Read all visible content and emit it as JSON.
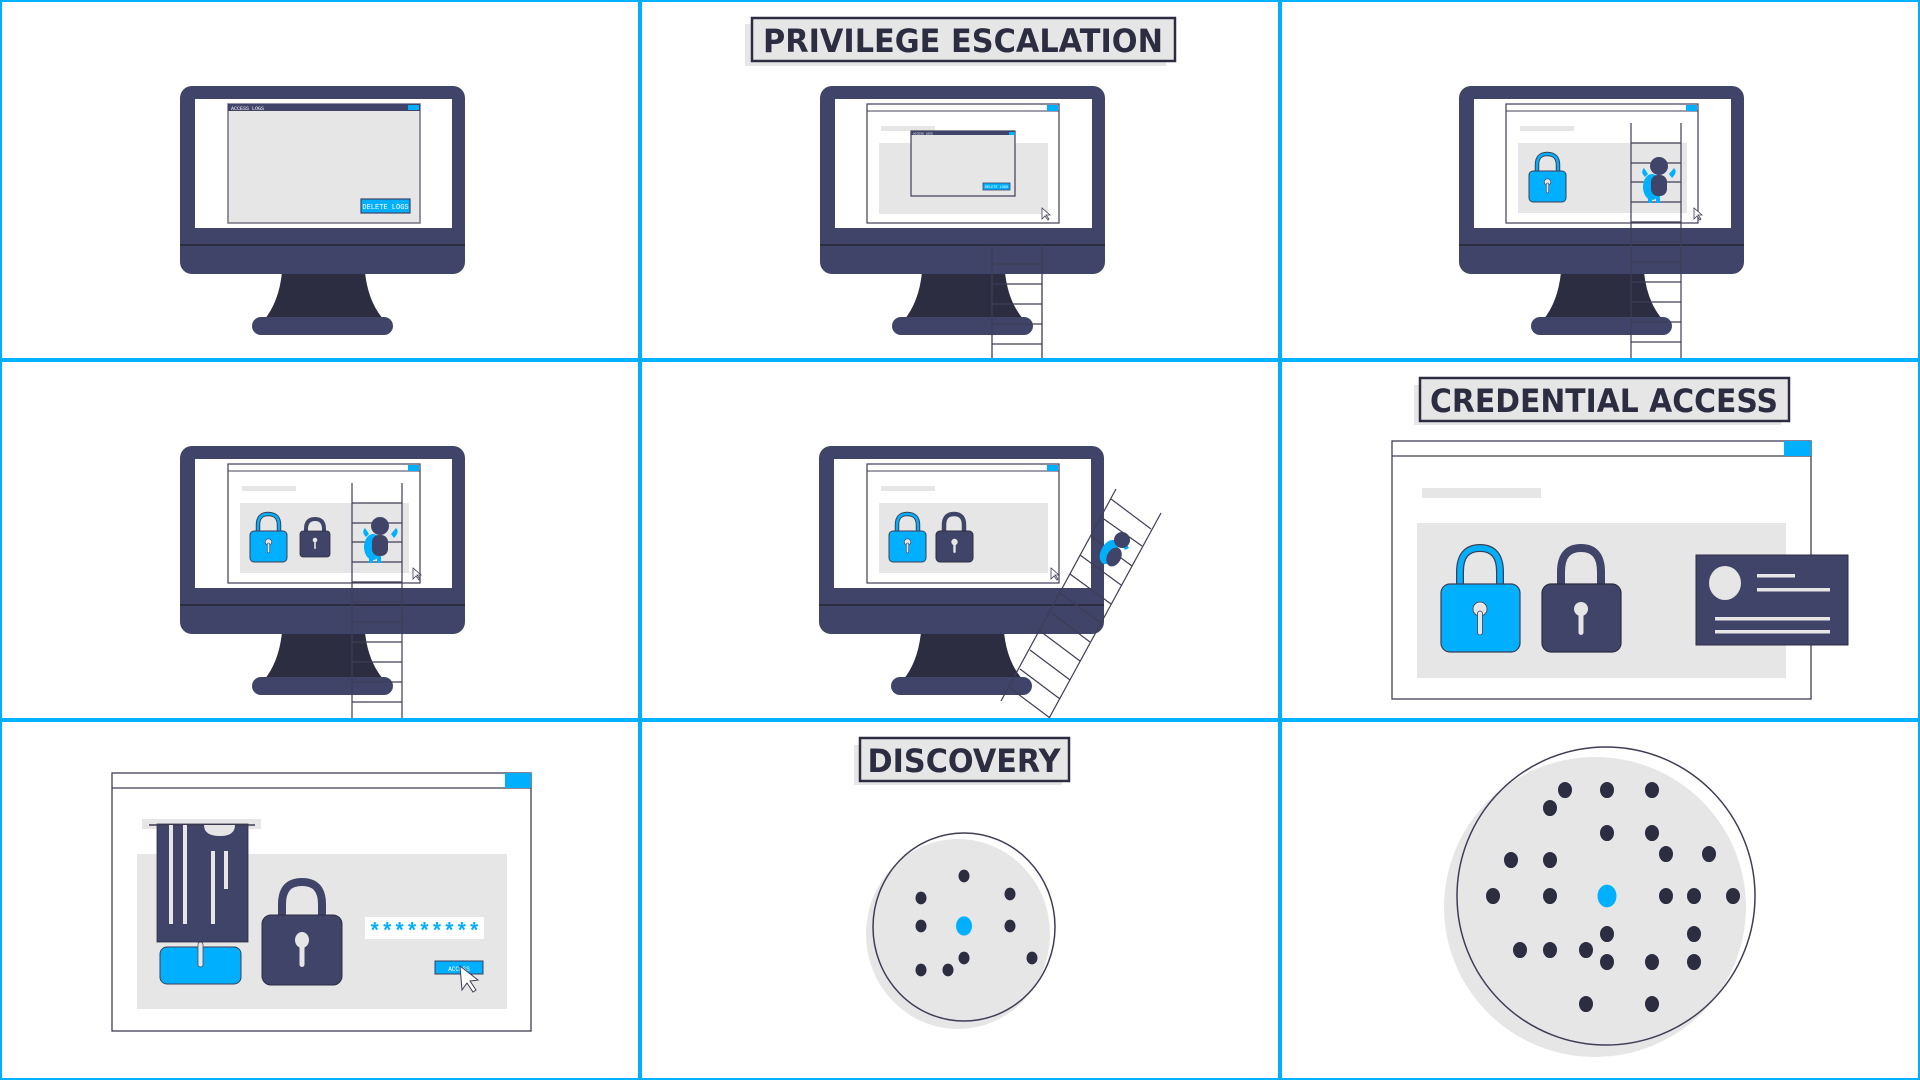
{
  "colors": {
    "accent": "#00b0ff",
    "navy": "#3f4468",
    "dark": "#2d2d42",
    "light_gray": "#e6e6e6",
    "outline": "#3f3d56",
    "white": "#ffffff"
  },
  "panels": [
    {
      "id": "panel-1",
      "title": "",
      "window_title": "ACCESS LOGS",
      "button_label": "DELETE LOGS"
    },
    {
      "id": "panel-2",
      "title": "PRIVILEGE ESCALATION",
      "window_title": "ACCESS LOGS",
      "button_label": "DELETE LOGS"
    },
    {
      "id": "panel-3",
      "title": "",
      "locks": [
        "unlocked-blue"
      ]
    },
    {
      "id": "panel-4",
      "title": "",
      "locks": [
        "unlocked-blue",
        "locked-navy"
      ]
    },
    {
      "id": "panel-5",
      "title": "",
      "locks": [
        "unlocked-blue",
        "locked-navy"
      ]
    },
    {
      "id": "panel-6",
      "title": "CREDENTIAL ACCESS",
      "locks": [
        "unlocked-blue",
        "locked-navy"
      ],
      "id_card": "user-id-card"
    },
    {
      "id": "panel-7",
      "title": "",
      "password_mask": "*********",
      "button_label": "ACCESS"
    },
    {
      "id": "panel-8",
      "title": "DISCOVERY",
      "network_nodes": 9,
      "center_node": "highlighted"
    },
    {
      "id": "panel-9",
      "title": "",
      "network_nodes": 27,
      "center_node": "highlighted"
    }
  ]
}
